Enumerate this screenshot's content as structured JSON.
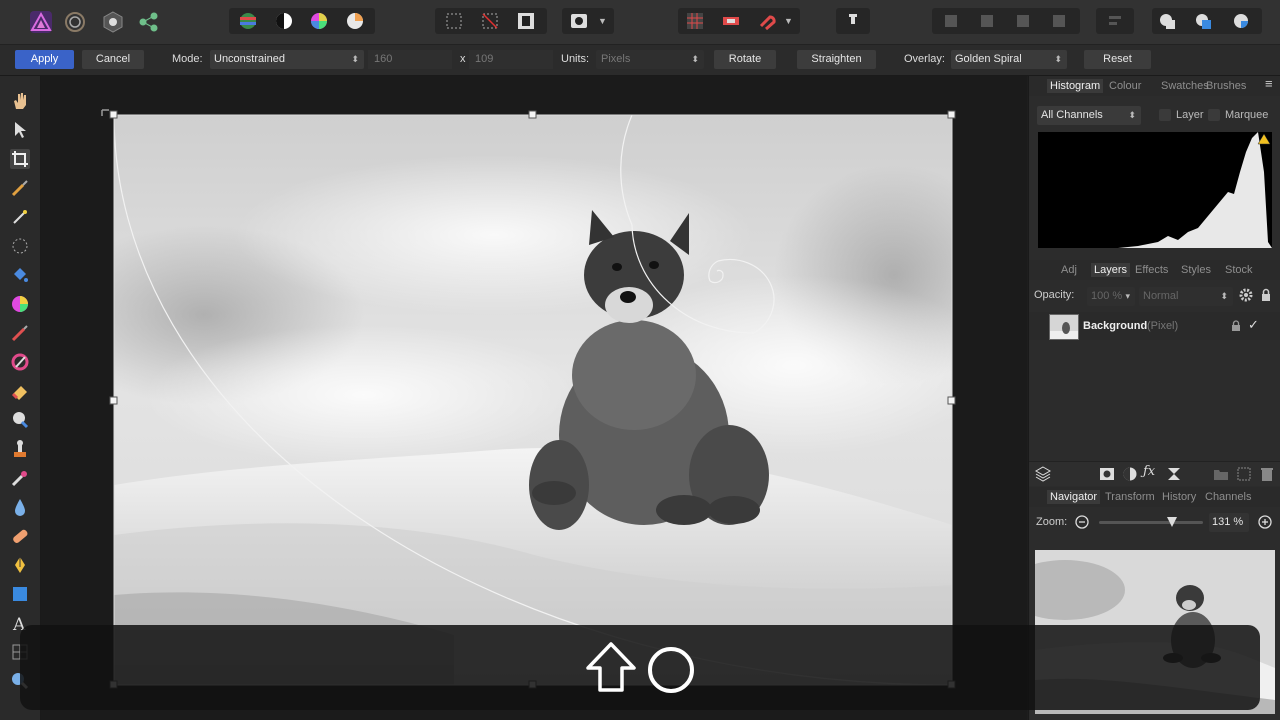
{
  "context_bar": {
    "apply": "Apply",
    "cancel": "Cancel",
    "mode_label": "Mode:",
    "mode_value": "Unconstrained",
    "width_value": "160",
    "x_sep": "x",
    "height_value": "109",
    "units_label": "Units:",
    "units_value": "Pixels",
    "rotate": "Rotate",
    "straighten": "Straighten",
    "overlay_label": "Overlay:",
    "overlay_value": "Golden Spiral",
    "reset": "Reset"
  },
  "top_panel": {
    "tabs": [
      "Histogram",
      "Colour",
      "Swatches",
      "Brushes"
    ],
    "channel_select": "All Channels",
    "layer_check": "Layer",
    "marquee_check": "Marquee"
  },
  "layers_panel": {
    "tabs": [
      "Adj",
      "Layers",
      "Effects",
      "Styles",
      "Stock"
    ],
    "opacity_label": "Opacity:",
    "opacity_value": "100 %",
    "blend_value": "Normal",
    "layer_name": "Background",
    "layer_type": "(Pixel)"
  },
  "nav_panel": {
    "tabs": [
      "Navigator",
      "Transform",
      "History",
      "Channels"
    ],
    "zoom_label": "Zoom:",
    "zoom_value": "131 %",
    "zoom_level": 0.7
  },
  "colors": {
    "accent": "#3a63c8",
    "toolbar": "#323232",
    "panel": "#2c2c2c"
  }
}
